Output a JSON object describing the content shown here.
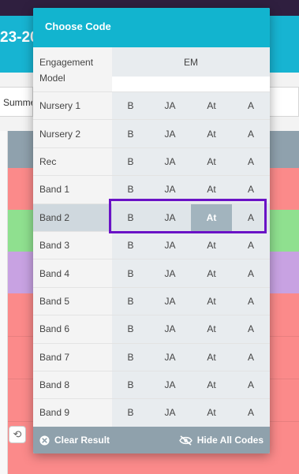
{
  "background": {
    "header_text": "23-20",
    "select_text": "Summe"
  },
  "modal": {
    "title": "Choose Code",
    "header_row": {
      "label": "Engagement Model",
      "code": "EM"
    },
    "rows": [
      {
        "label": "Nursery 1",
        "codes": [
          "B",
          "JA",
          "At",
          "A"
        ]
      },
      {
        "label": "Nursery 2",
        "codes": [
          "B",
          "JA",
          "At",
          "A"
        ]
      },
      {
        "label": "Rec",
        "codes": [
          "B",
          "JA",
          "At",
          "A"
        ]
      },
      {
        "label": "Band 1",
        "codes": [
          "B",
          "JA",
          "At",
          "A"
        ]
      },
      {
        "label": "Band 2",
        "codes": [
          "B",
          "JA",
          "At",
          "A"
        ],
        "selected": true,
        "active_code": "At"
      },
      {
        "label": "Band 3",
        "codes": [
          "B",
          "JA",
          "At",
          "A"
        ]
      },
      {
        "label": "Band 4",
        "codes": [
          "B",
          "JA",
          "At",
          "A"
        ]
      },
      {
        "label": "Band 5",
        "codes": [
          "B",
          "JA",
          "At",
          "A"
        ]
      },
      {
        "label": "Band 6",
        "codes": [
          "B",
          "JA",
          "At",
          "A"
        ]
      },
      {
        "label": "Band 7",
        "codes": [
          "B",
          "JA",
          "At",
          "A"
        ]
      },
      {
        "label": "Band 8",
        "codes": [
          "B",
          "JA",
          "At",
          "A"
        ]
      },
      {
        "label": "Band 9",
        "codes": [
          "B",
          "JA",
          "At",
          "A"
        ]
      }
    ],
    "footer": {
      "clear_label": "Clear Result",
      "clear_icon": "close-circle-icon",
      "hide_label": "Hide All Codes",
      "hide_icon": "eye-slash-icon"
    }
  },
  "colors": {
    "accent": "#12b4cf",
    "highlight": "#6a12c6",
    "row_red": "#fb8a8a",
    "row_green": "#8fe08f",
    "row_purple": "#c8a2e2"
  }
}
